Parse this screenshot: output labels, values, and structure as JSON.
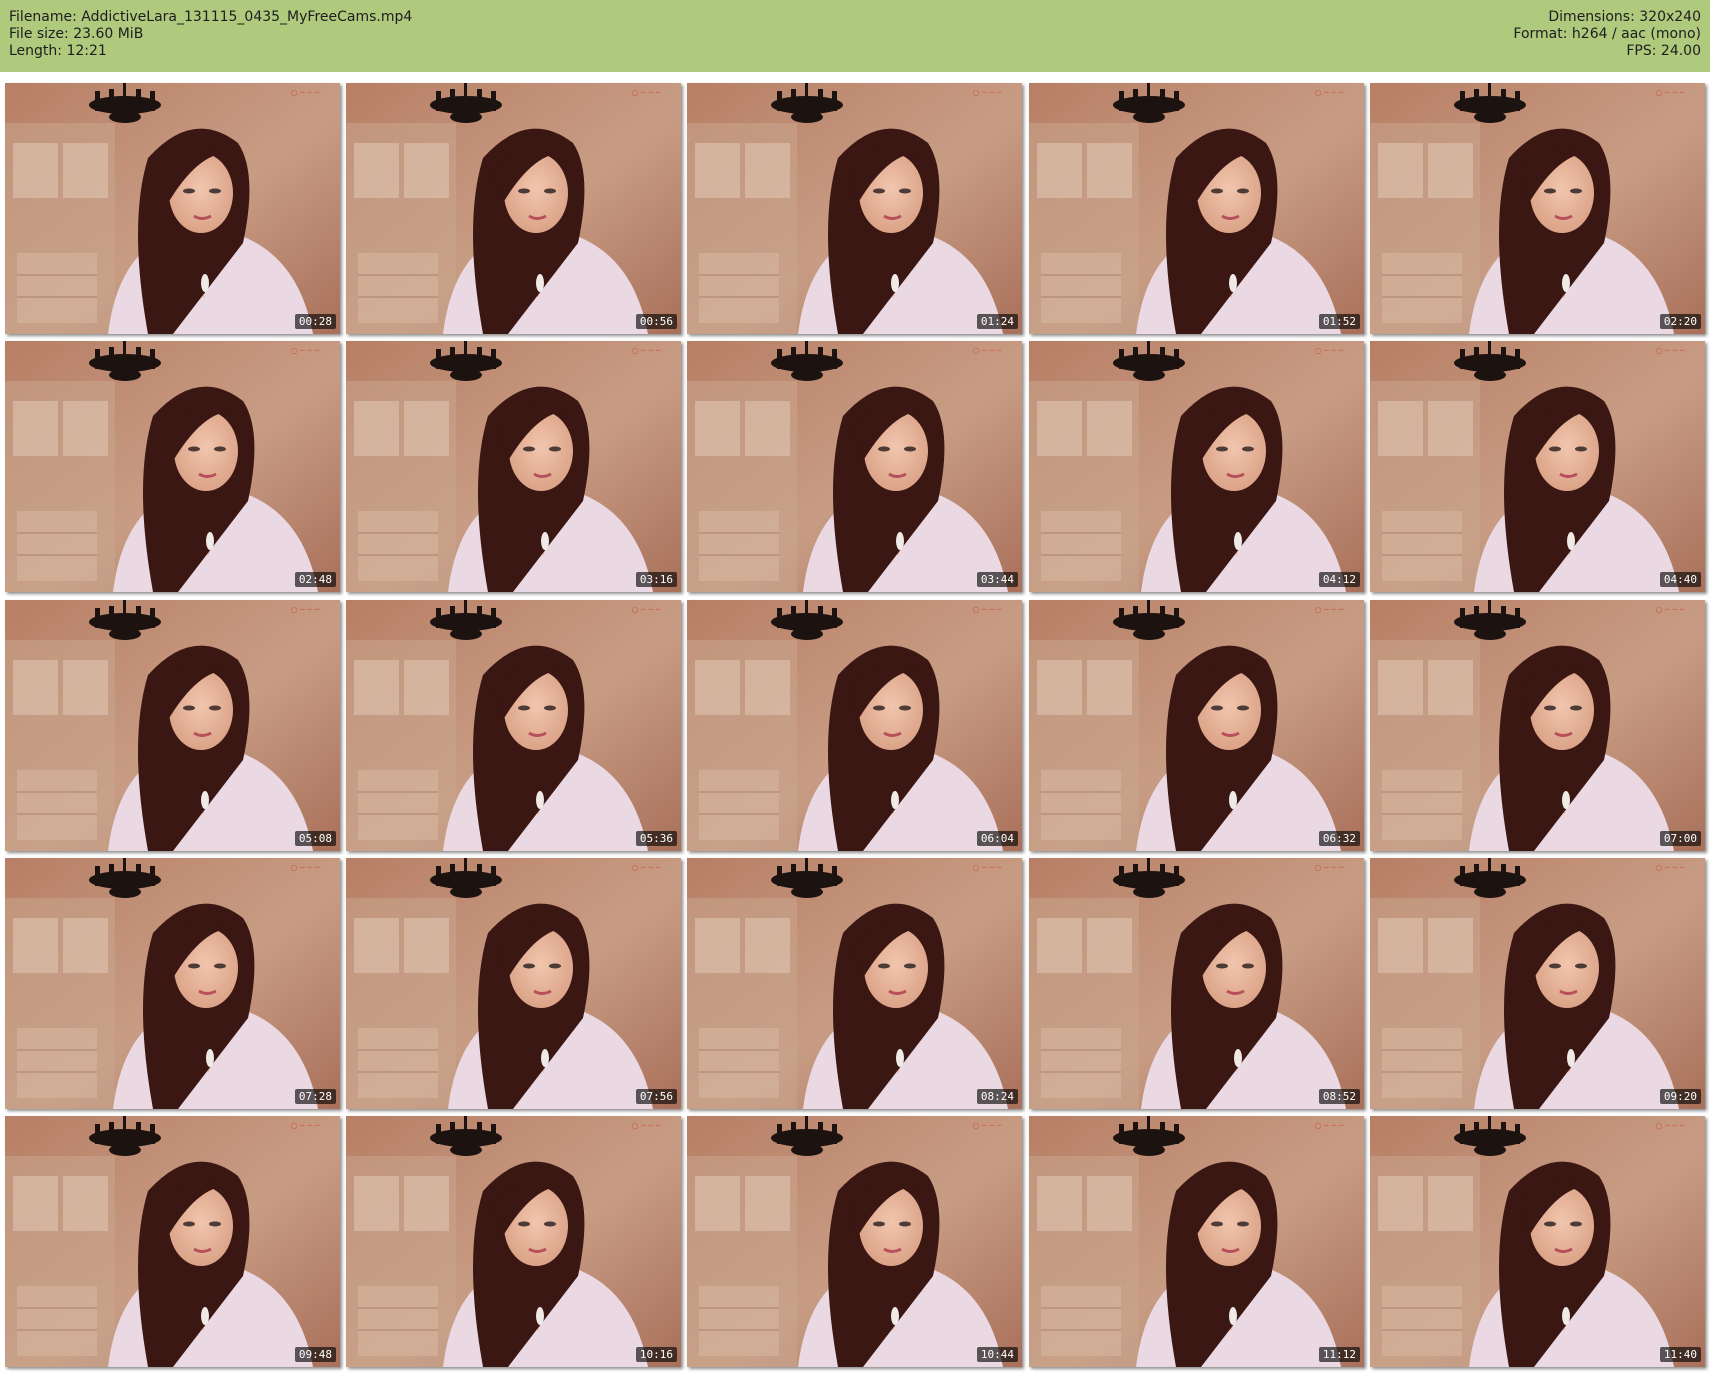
{
  "header": {
    "filename": "Filename: AddictiveLara_131115_0435_MyFreeCams.mp4",
    "filesize": "File size: 23.60 MiB",
    "length": "Length: 12:21",
    "dimensions": "Dimensions: 320x240",
    "format": "Format: h264 / aac (mono)",
    "fps": "FPS: 24.00"
  },
  "colors": {
    "header_bg": "#afc97d",
    "page_bg": "#ffffff"
  },
  "thumbnails": [
    {
      "timestamp": "00:28"
    },
    {
      "timestamp": "00:56"
    },
    {
      "timestamp": "01:24"
    },
    {
      "timestamp": "01:52"
    },
    {
      "timestamp": "02:20"
    },
    {
      "timestamp": "02:48"
    },
    {
      "timestamp": "03:16"
    },
    {
      "timestamp": "03:44"
    },
    {
      "timestamp": "04:12"
    },
    {
      "timestamp": "04:40"
    },
    {
      "timestamp": "05:08"
    },
    {
      "timestamp": "05:36"
    },
    {
      "timestamp": "06:04"
    },
    {
      "timestamp": "06:32"
    },
    {
      "timestamp": "07:00"
    },
    {
      "timestamp": "07:28"
    },
    {
      "timestamp": "07:56"
    },
    {
      "timestamp": "08:24"
    },
    {
      "timestamp": "08:52"
    },
    {
      "timestamp": "09:20"
    },
    {
      "timestamp": "09:48"
    },
    {
      "timestamp": "10:16"
    },
    {
      "timestamp": "10:44"
    },
    {
      "timestamp": "11:12"
    },
    {
      "timestamp": "11:40"
    }
  ]
}
